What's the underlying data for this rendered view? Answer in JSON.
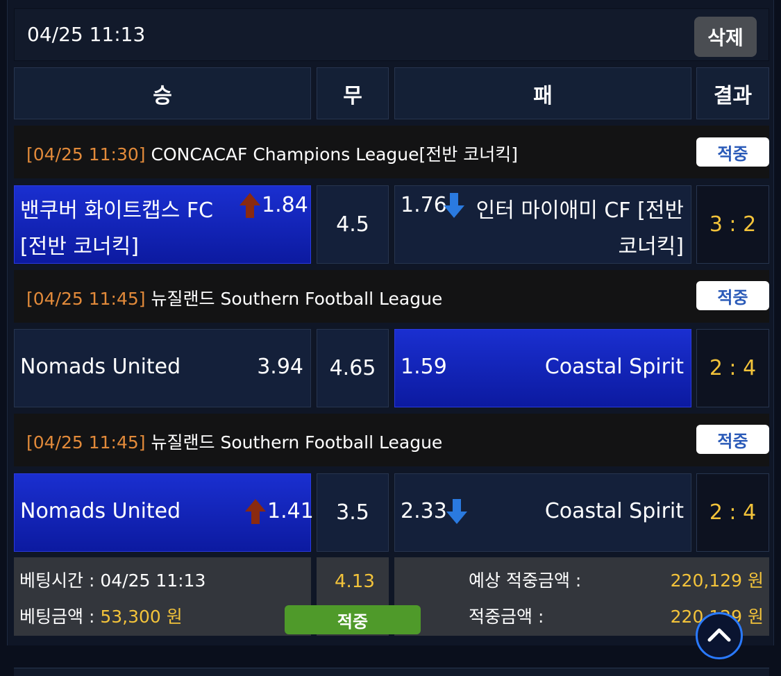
{
  "header": {
    "datetime": "04/25 11:13",
    "delete_label": "삭제"
  },
  "columns": {
    "win": "승",
    "draw": "무",
    "lose": "패",
    "result": "결과"
  },
  "hit_label": "적중",
  "games": [
    {
      "league_time": "[04/25 11:30]",
      "league_name": "CONCACAF Champions League[전반 코너킥]",
      "home_line1": "밴쿠버 화이트캡스 FC",
      "home_line2": "[전반 코너킥]",
      "home_odds": "1.84",
      "home_arrow": "up",
      "draw_odds": "4.5",
      "away_odds": "1.76",
      "away_arrow": "down",
      "away_line1": "인터 마이애미 CF [전반",
      "away_line2": "코너킥]",
      "score": "3 : 2",
      "selected": "home"
    },
    {
      "league_time": "[04/25 11:45]",
      "league_name": "뉴질랜드 Southern Football League",
      "home_team": "Nomads United",
      "home_odds": "3.94",
      "draw_odds": "4.65",
      "away_odds": "1.59",
      "away_team": "Coastal Spirit",
      "score": "2 : 4",
      "selected": "away"
    },
    {
      "league_time": "[04/25 11:45]",
      "league_name": "뉴질랜드 Southern Football League",
      "home_team": "Nomads United",
      "home_odds": "1.41",
      "home_arrow": "up",
      "draw_odds": "3.5",
      "away_odds": "2.33",
      "away_arrow": "down",
      "away_team": "Coastal Spirit",
      "score": "2 : 4",
      "selected": "home"
    }
  ],
  "summary": {
    "bet_time_label": "베팅시간 :",
    "bet_time_value": "04/25 11:13",
    "bet_amount_label": "베팅금액 :",
    "bet_amount_value": "53,300 원",
    "total_odds": "4.13",
    "status": "적중",
    "expected_label": "예상 적중금액 :",
    "expected_value": "220,129 원",
    "won_label": "적중금액 :",
    "won_value": "220,129 원"
  },
  "colors": {
    "selected_cell": "#1a2fd0",
    "score_gold": "#f3c33a",
    "league_time_orange": "#e28a3a",
    "arrow_up": "#8a2a10",
    "arrow_down": "#2a7ae0",
    "hit_green": "#4f9a2a"
  },
  "icons": {
    "up_arrow": "arrow-up-icon",
    "down_arrow": "arrow-down-icon",
    "scroll_top": "chevron-up-icon"
  }
}
